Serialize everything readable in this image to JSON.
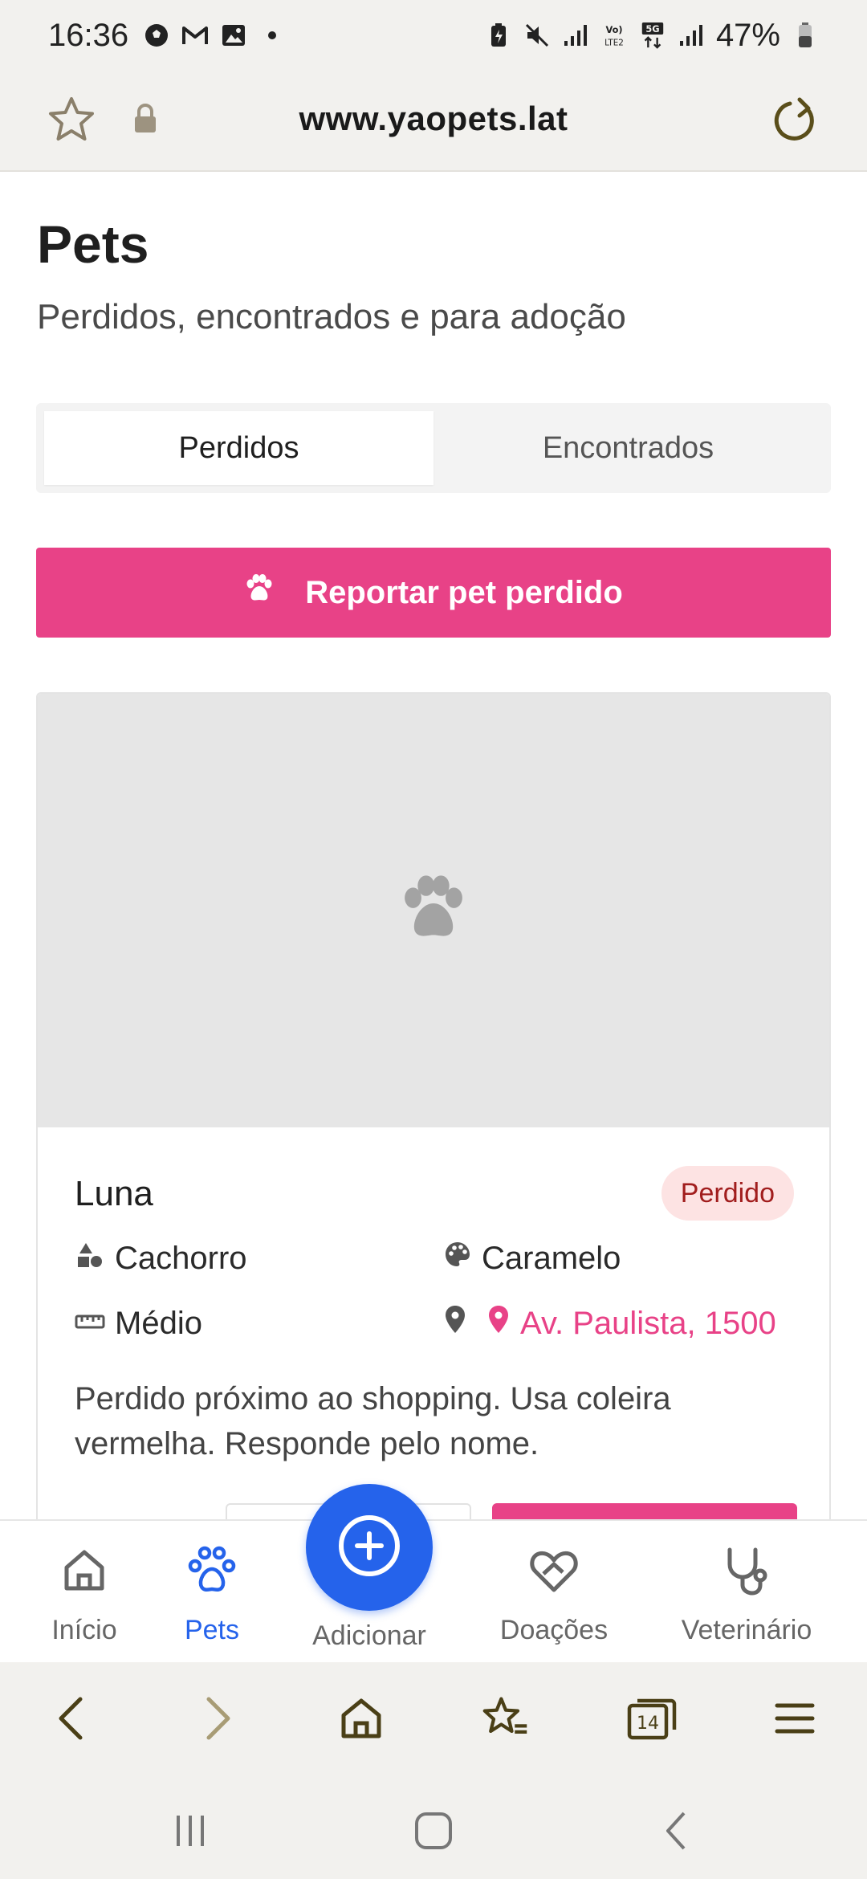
{
  "status_bar": {
    "time": "16:36",
    "battery": "47%"
  },
  "browser": {
    "url": "www.yaopets.lat",
    "tab_count": "14"
  },
  "page": {
    "title": "Pets",
    "subtitle": "Perdidos, encontrados e para adoção",
    "tabs": [
      {
        "label": "Perdidos",
        "active": true
      },
      {
        "label": "Encontrados",
        "active": false
      }
    ],
    "report_button": "Reportar pet perdido"
  },
  "pet_card": {
    "name": "Luna",
    "status": "Perdido",
    "species": "Cachorro",
    "color": "Caramelo",
    "size": "Médio",
    "location": "Av. Paulista, 1500",
    "description": "Perdido próximo ao shopping. Usa coleira vermelha. Responde pelo nome."
  },
  "bottom_nav": {
    "items": [
      {
        "label": "Início",
        "icon": "home-icon"
      },
      {
        "label": "Pets",
        "icon": "paw-icon",
        "active": true
      },
      {
        "label": "Adicionar",
        "icon": "plus-circle-icon"
      },
      {
        "label": "Doações",
        "icon": "heart-hand-icon"
      },
      {
        "label": "Veterinário",
        "icon": "stethoscope-icon"
      }
    ]
  },
  "colors": {
    "accent_pink": "#e84287",
    "accent_blue": "#2563eb",
    "browser_chrome": "#f2f1ee"
  }
}
